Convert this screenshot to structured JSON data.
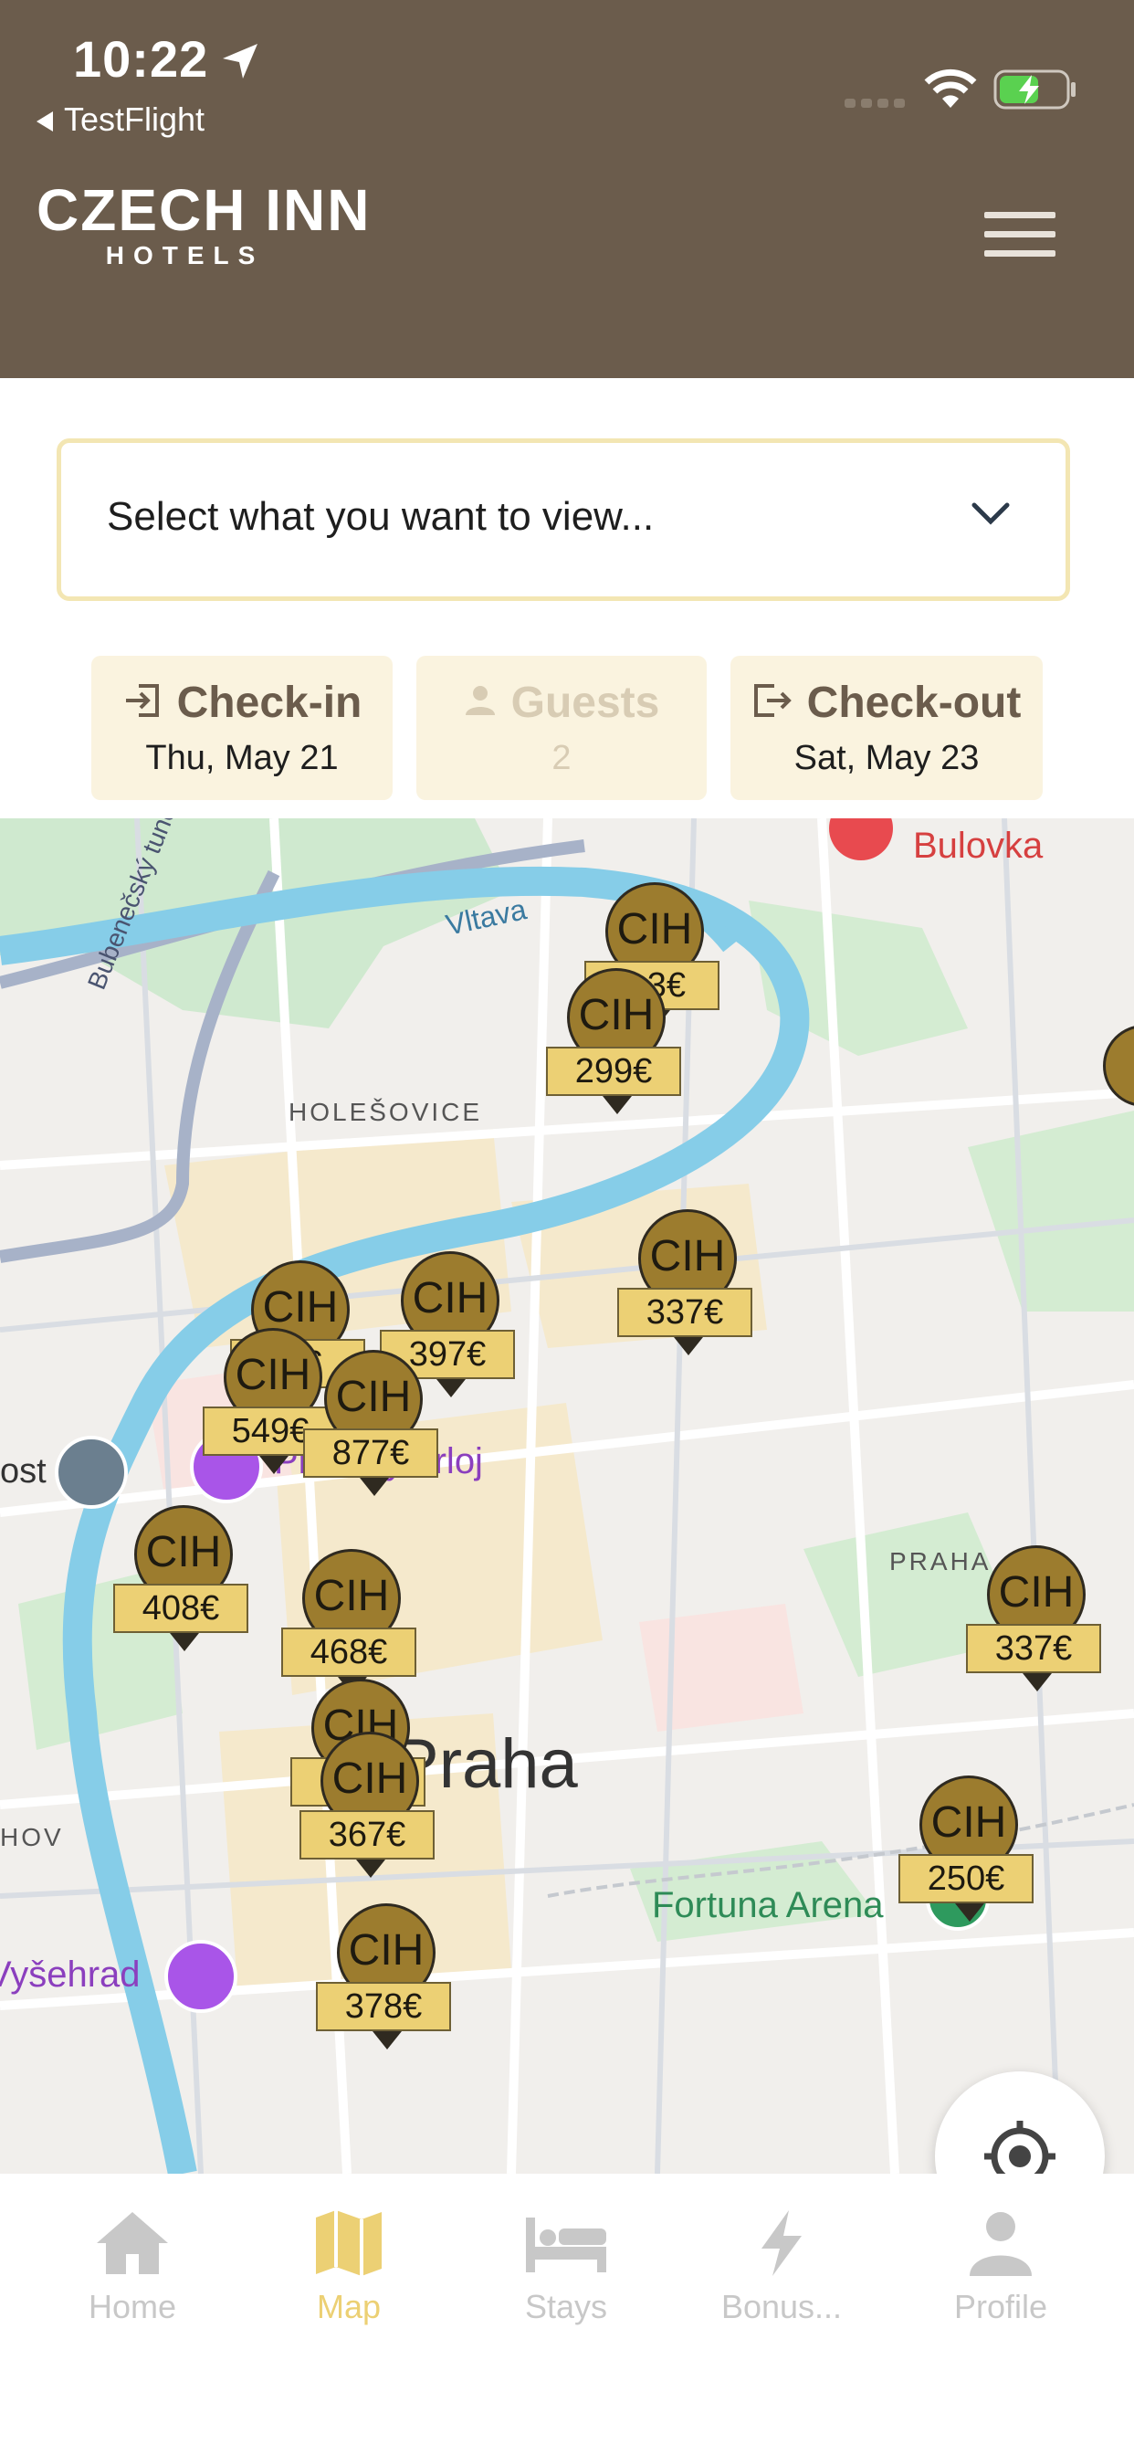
{
  "status_bar": {
    "time": "10:22",
    "back_app": "TestFlight"
  },
  "header": {
    "logo_line1": "CZECH INN",
    "logo_line2": "HOTELS"
  },
  "selector": {
    "placeholder": "Select what you want to view..."
  },
  "dates": {
    "checkin_label": "Check-in",
    "checkin_value": "Thu, May 21",
    "guests_label": "Guests",
    "guests_value": "2",
    "checkout_label": "Check-out",
    "checkout_value": "Sat, May 23"
  },
  "map": {
    "labels": {
      "vltava": "Vltava",
      "bulovka": "Bulovka",
      "tunel": "Bubenečský tunel",
      "holesovice": "HOLEŠOVICE",
      "praha_area": "PRAHA",
      "praha_city": "Praha",
      "fortuna": "Fortuna Arena",
      "vysehrad": "Vyšehrad",
      "orloj": "Pražský orloj",
      "ost": "ost",
      "hov": "HOV"
    },
    "pin_label": "CIH",
    "pins": [
      {
        "price": "...3€"
      },
      {
        "price": "299€"
      },
      {
        "price": "337€"
      },
      {
        "price": "397€"
      },
      {
        "price": "...€"
      },
      {
        "price": "549€"
      },
      {
        "price": "877€"
      },
      {
        "price": "408€"
      },
      {
        "price": "468€"
      },
      {
        "price": "..."
      },
      {
        "price": "367€"
      },
      {
        "price": "337€"
      },
      {
        "price": "250€"
      },
      {
        "price": "378€"
      }
    ]
  },
  "tabs": [
    {
      "label": "Home",
      "icon": "home-icon"
    },
    {
      "label": "Map",
      "icon": "map-icon",
      "active": true
    },
    {
      "label": "Stays",
      "icon": "bed-icon"
    },
    {
      "label": "Bonus...",
      "icon": "lightning-icon"
    },
    {
      "label": "Profile",
      "icon": "profile-icon"
    }
  ],
  "colors": {
    "header": "#6b5c4c",
    "accent": "#ecd074",
    "pin": "#9c7c2e"
  }
}
